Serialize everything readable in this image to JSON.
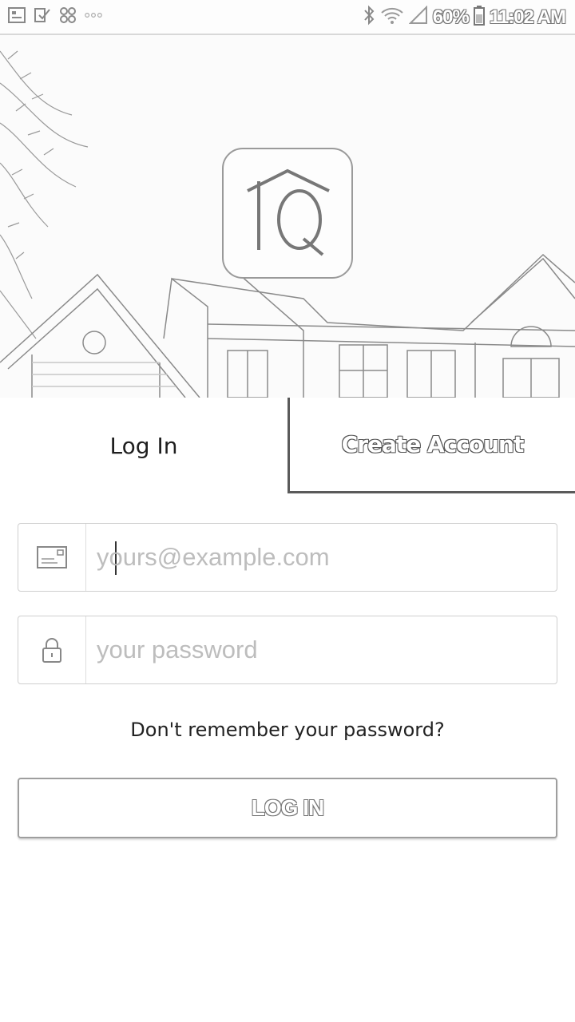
{
  "status_bar": {
    "battery": "60%",
    "time": "11:02 AM",
    "left_icons": [
      "gallery-icon",
      "check-message-icon",
      "pinwheel-icon",
      "more-dots-icon"
    ],
    "right_icons": [
      "bluetooth-icon",
      "wifi-icon",
      "signal-icon",
      "battery-icon"
    ]
  },
  "hero": {
    "logo_text": "IQ"
  },
  "tabs": {
    "login": "Log In",
    "create": "Create Account"
  },
  "form": {
    "email_placeholder": "yours@example.com",
    "email_value": "",
    "password_placeholder": "your password",
    "password_value": "",
    "forgot": "Don't remember your password?",
    "submit": "LOG IN"
  },
  "colors": {
    "border": "#cfcfcf",
    "outline_text": "#777777"
  }
}
